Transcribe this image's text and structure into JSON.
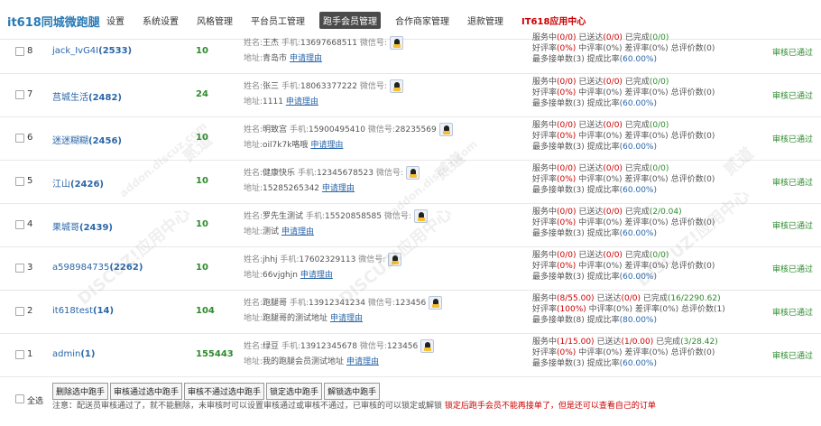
{
  "header": {
    "brand": "it618同城微跑腿",
    "nav": [
      "设置",
      "系统设置",
      "风格管理",
      "平台员工管理",
      "跑手会员管理",
      "合作商家管理",
      "退款管理",
      "IT618应用中心"
    ],
    "active_index": 4
  },
  "labels": {
    "name": "姓名:",
    "phone": "手机:",
    "wechat": "微信号:",
    "address": "地址:",
    "apply_reason": "申请理由"
  },
  "rows": [
    {
      "num": "8",
      "user": "jack_IvG4I",
      "uid": "2533",
      "level": "10",
      "name": "王杰",
      "phone": "13697668511",
      "wechat": "",
      "address": "青岛市",
      "s1": [
        "服务中",
        "(0/0)",
        "已送达",
        "(0/0)",
        "已完成",
        "(0/0)"
      ],
      "s2": [
        "好评率",
        "(0%)",
        "中评率(0%)",
        "差评率(0%)",
        "总评价数(0)"
      ],
      "s3": [
        "最多接单数",
        "(3)",
        "提成比率",
        "(60.00%)"
      ],
      "status": "审核已通过"
    },
    {
      "num": "7",
      "user": "莒城生活",
      "uid": "2482",
      "level": "24",
      "name": "张三",
      "phone": "18063377222",
      "wechat": "",
      "address": "1111",
      "s1": [
        "服务中",
        "(0/0)",
        "已送达",
        "(0/0)",
        "已完成",
        "(0/0)"
      ],
      "s2": [
        "好评率",
        "(0%)",
        "中评率(0%)",
        "差评率(0%)",
        "总评价数(0)"
      ],
      "s3": [
        "最多接单数",
        "(3)",
        "提成比率",
        "(60.00%)"
      ],
      "status": "审核已通过"
    },
    {
      "num": "6",
      "user": "迷迷糊糊",
      "uid": "2456",
      "level": "10",
      "name": "明致宫",
      "phone": "15900495410",
      "wechat": "28235569",
      "address": "oil7k7k咯哦",
      "s1": [
        "服务中",
        "(0/0)",
        "已送达",
        "(0/0)",
        "已完成",
        "(0/0)"
      ],
      "s2": [
        "好评率",
        "(0%)",
        "中评率(0%)",
        "差评率(0%)",
        "总评价数(0)"
      ],
      "s3": [
        "最多接单数",
        "(3)",
        "提成比率",
        "(60.00%)"
      ],
      "status": "审核已通过"
    },
    {
      "num": "5",
      "user": "江山",
      "uid": "2426",
      "level": "10",
      "name": "健康快乐",
      "phone": "12345678523",
      "wechat": "",
      "address": "15285265342",
      "s1": [
        "服务中",
        "(0/0)",
        "已送达",
        "(0/0)",
        "已完成",
        "(0/0)"
      ],
      "s2": [
        "好评率",
        "(0%)",
        "中评率(0%)",
        "差评率(0%)",
        "总评价数(0)"
      ],
      "s3": [
        "最多接单数",
        "(3)",
        "提成比率",
        "(60.00%)"
      ],
      "status": "审核已通过"
    },
    {
      "num": "4",
      "user": "果城哥",
      "uid": "2439",
      "level": "10",
      "name": "罗先生测试",
      "phone": "15520858585",
      "wechat": "",
      "address": "测试",
      "s1": [
        "服务中",
        "(0/0)",
        "已送达",
        "(0/0)",
        "已完成",
        "(2/0.04)"
      ],
      "s2": [
        "好评率",
        "(0%)",
        "中评率(0%)",
        "差评率(0%)",
        "总评价数(0)"
      ],
      "s3": [
        "最多接单数",
        "(3)",
        "提成比率",
        "(60.00%)"
      ],
      "status": "审核已通过"
    },
    {
      "num": "3",
      "user": "a598984735",
      "uid": "2262",
      "level": "10",
      "name": "jhhj",
      "phone": "17602329113",
      "wechat": "",
      "address": "66vjghjn",
      "s1": [
        "服务中",
        "(0/0)",
        "已送达",
        "(0/0)",
        "已完成",
        "(0/0)"
      ],
      "s2": [
        "好评率",
        "(0%)",
        "中评率(0%)",
        "差评率(0%)",
        "总评价数(0)"
      ],
      "s3": [
        "最多接单数",
        "(3)",
        "提成比率",
        "(60.00%)"
      ],
      "status": "审核已通过"
    },
    {
      "num": "2",
      "user": "it618test",
      "uid": "14",
      "level": "104",
      "name": "跑腿哥",
      "phone": "13912341234",
      "wechat": "123456",
      "address": "跑腿哥的测试地址",
      "s1": [
        "服务中",
        "(8/55.00)",
        "已送达",
        "(0/0)",
        "已完成",
        "(16/2290.62)"
      ],
      "s2": [
        "好评率",
        "(100%)",
        "中评率(0%)",
        "差评率(0%)",
        "总评价数(1)"
      ],
      "s3": [
        "最多接单数",
        "(8)",
        "提成比率",
        "(80.00%)"
      ],
      "status": "审核已通过"
    },
    {
      "num": "1",
      "user": "admin",
      "uid": "1",
      "level": "155443",
      "name": "绿豆",
      "phone": "13912345678",
      "wechat": "123456",
      "address": "我的跑腿会员测试地址",
      "s1": [
        "服务中",
        "(1/15.00)",
        "已送达",
        "(1/0.00)",
        "已完成",
        "(3/28.42)"
      ],
      "s2": [
        "好评率",
        "(0%)",
        "中评率(0%)",
        "差评率(0%)",
        "总评价数(0)"
      ],
      "s3": [
        "最多接单数",
        "(3)",
        "提成比率",
        "(60.00%)"
      ],
      "status": "审核已通过"
    }
  ],
  "footer": {
    "select_all": "全选",
    "buttons": [
      "删除选中跑手",
      "审核通过选中跑手",
      "审核不通过选中跑手",
      "锁定选中跑手",
      "解锁选中跑手"
    ],
    "note": "注意：配送员审核通过了，就不能删除，未审核时可以设置审核通过或审核不通过，已审核的可以锁定或解锁",
    "note_red": "锁定后跑手会员不能再接单了，但是还可以查看自己的订单"
  },
  "watermark": [
    "DISCUZ!应用中心",
    "addon.discuz.com",
    "贰道"
  ]
}
